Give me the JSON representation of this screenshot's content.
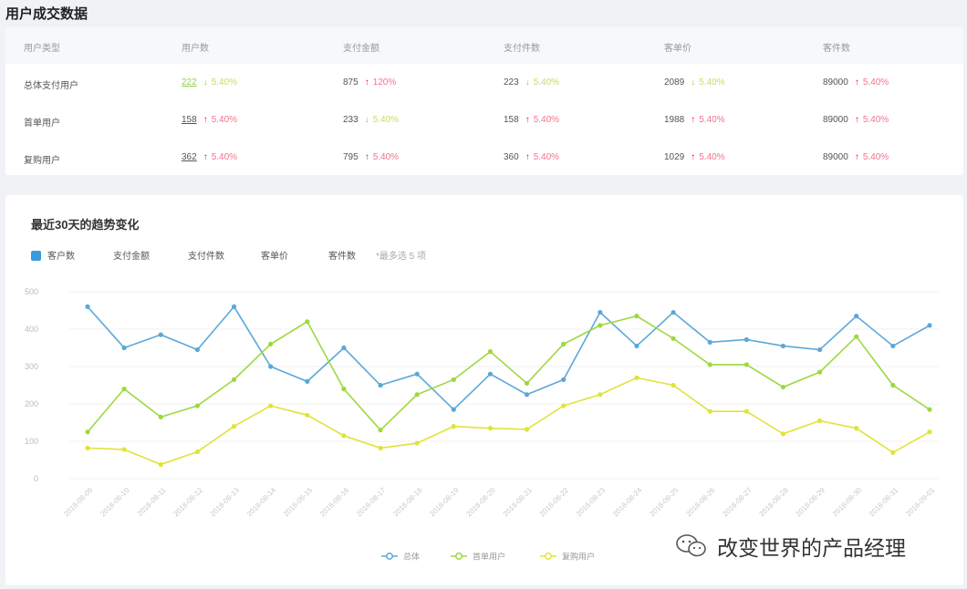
{
  "page": {
    "title": "用户成交数据"
  },
  "table": {
    "headers": [
      "用户类型",
      "用户数",
      "支付金额",
      "支付件数",
      "客单价",
      "客件数"
    ],
    "rows": [
      {
        "label": "总体支付用户",
        "cells": [
          {
            "value": "222",
            "dir": "down",
            "pct": "5.40%"
          },
          {
            "value": "875",
            "dir": "up",
            "pct": "120%"
          },
          {
            "value": "223",
            "dir": "down",
            "pct": "5.40%"
          },
          {
            "value": "2089",
            "dir": "down",
            "pct": "5.40%"
          },
          {
            "value": "89000",
            "dir": "up",
            "pct": "5.40%"
          }
        ]
      },
      {
        "label": "首单用户",
        "cells": [
          {
            "value": "158",
            "dir": "up",
            "pct": "5.40%"
          },
          {
            "value": "233",
            "dir": "down",
            "pct": "5.40%"
          },
          {
            "value": "158",
            "dir": "up",
            "pct": "5.40%"
          },
          {
            "value": "1988",
            "dir": "up",
            "pct": "5.40%"
          },
          {
            "value": "89000",
            "dir": "up",
            "pct": "5.40%"
          }
        ]
      },
      {
        "label": "复购用户",
        "cells": [
          {
            "value": "362",
            "dir": "up",
            "pct": "5.40%"
          },
          {
            "value": "795",
            "dir": "up",
            "pct": "5.40%"
          },
          {
            "value": "360",
            "dir": "up",
            "pct": "5.40%"
          },
          {
            "value": "1029",
            "dir": "up",
            "pct": "5.40%"
          },
          {
            "value": "89000",
            "dir": "up",
            "pct": "5.40%"
          }
        ]
      }
    ]
  },
  "chart": {
    "title": "最近30天的趋势变化",
    "tabs": [
      "客户数",
      "支付金额",
      "支付件数",
      "客单价",
      "客件数"
    ],
    "hint": "*最多选 5 项"
  },
  "chart_data": {
    "type": "line",
    "ylim": [
      0,
      500
    ],
    "yticks": [
      "0",
      "100",
      "200",
      "300",
      "400",
      "500"
    ],
    "x": [
      "2018-08-09",
      "2018-08-10",
      "2018-08-11",
      "2018-08-12",
      "2018-08-13",
      "2018-08-14",
      "2018-08-15",
      "2018-08-16",
      "2018-08-17",
      "2018-08-18",
      "2018-08-19",
      "2018-08-20",
      "2018-08-21",
      "2018-08-22",
      "2018-08-23",
      "2018-08-24",
      "2018-08-25",
      "2018-08-26",
      "2018-08-27",
      "2018-08-28",
      "2018-08-29",
      "2018-08-30",
      "2018-08-31",
      "2018-09-01"
    ],
    "series": [
      {
        "name": "总体",
        "color": "#5ba8d8",
        "values": [
          460,
          350,
          385,
          345,
          460,
          300,
          260,
          350,
          250,
          280,
          185,
          280,
          225,
          265,
          445,
          355,
          445,
          365,
          372,
          355,
          345,
          435,
          355,
          410
        ]
      },
      {
        "name": "首单用户",
        "color": "#9ed840",
        "values": [
          125,
          240,
          165,
          195,
          265,
          360,
          420,
          240,
          130,
          225,
          265,
          340,
          255,
          360,
          410,
          435,
          375,
          305,
          305,
          245,
          285,
          380,
          250,
          185
        ]
      },
      {
        "name": "复购用户",
        "color": "#e2e23a",
        "values": [
          82,
          78,
          38,
          72,
          140,
          195,
          170,
          115,
          82,
          95,
          140,
          135,
          132,
          195,
          225,
          270,
          250,
          180,
          180,
          120,
          155,
          135,
          70,
          125
        ]
      }
    ]
  },
  "watermark": "改变世界的产品经理"
}
